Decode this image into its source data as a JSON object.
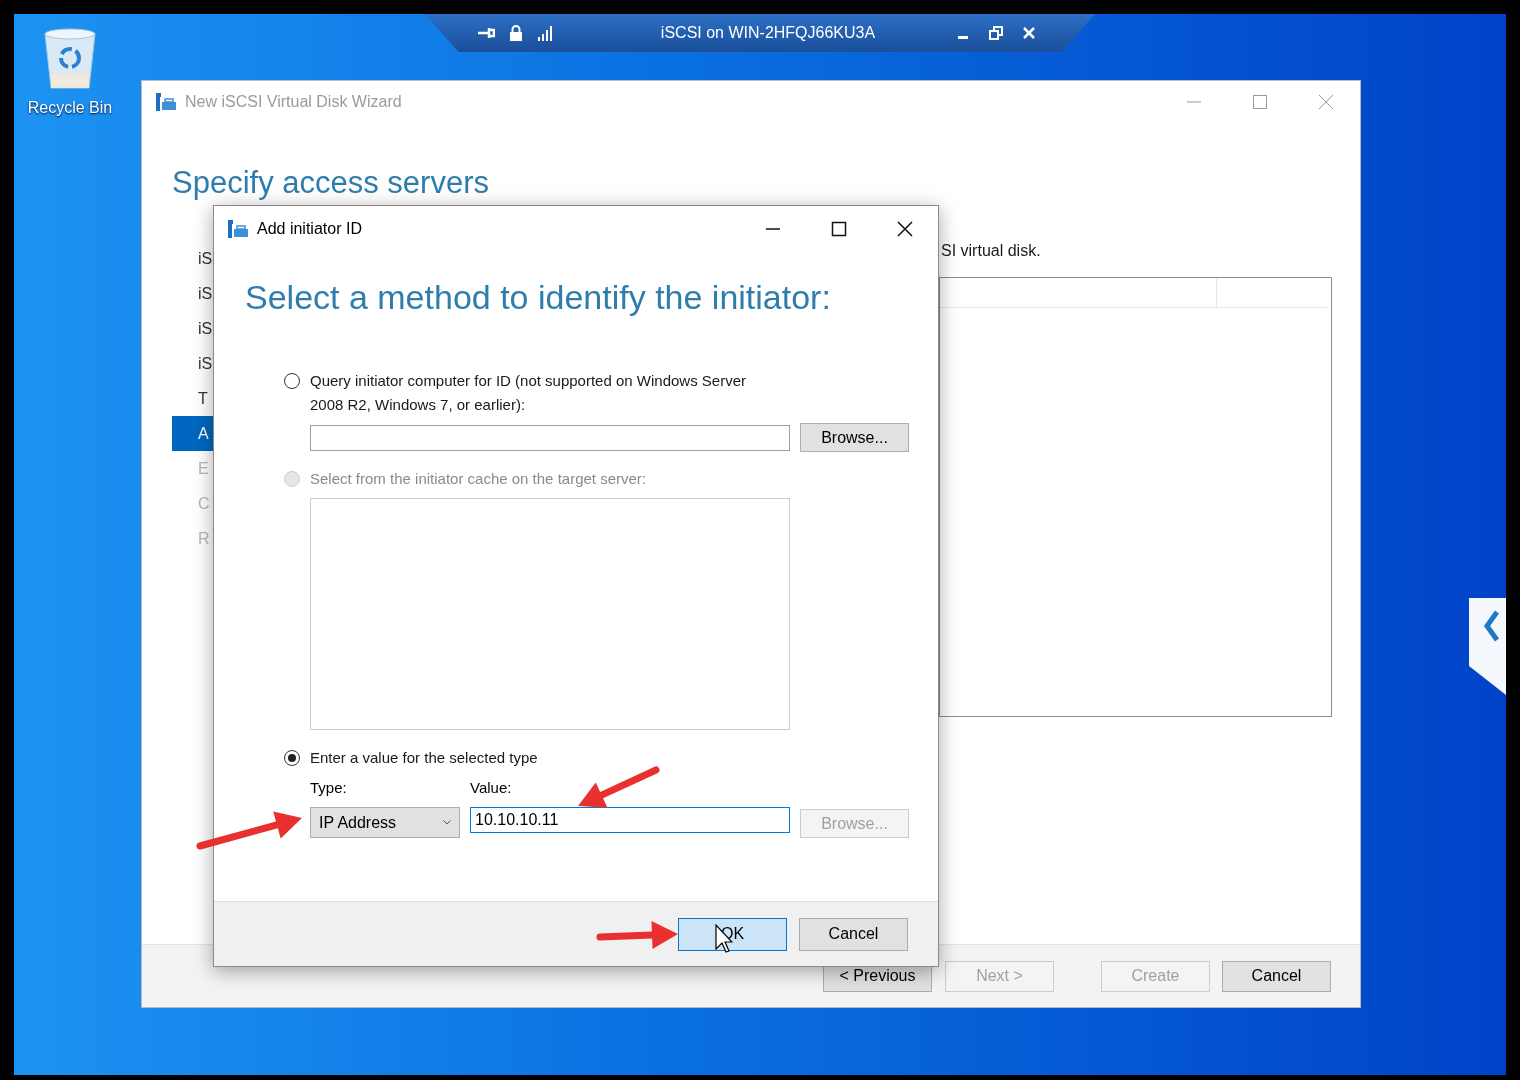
{
  "remote_bar": {
    "title": "iSCSI on WIN-2HFQJ66KU3A"
  },
  "desktop_icons": [
    {
      "label": "Recycle Bin"
    }
  ],
  "wizard": {
    "title": "New iSCSI Virtual Disk Wizard",
    "heading": "Specify access servers",
    "steps": [
      {
        "label": "iS",
        "selected": false,
        "disabled": false
      },
      {
        "label": "iS",
        "selected": false,
        "disabled": false
      },
      {
        "label": "iS",
        "selected": false,
        "disabled": false
      },
      {
        "label": "iS",
        "selected": false,
        "disabled": false
      },
      {
        "label": "T",
        "selected": false,
        "disabled": false
      },
      {
        "label": "A",
        "selected": true,
        "disabled": false
      },
      {
        "label": "E",
        "selected": false,
        "disabled": true
      },
      {
        "label": "C",
        "selected": false,
        "disabled": true
      },
      {
        "label": "R",
        "selected": false,
        "disabled": true
      }
    ],
    "description": "SI virtual disk.",
    "nav_buttons": [
      {
        "label": "< Previous",
        "disabled": false
      },
      {
        "label": "Next >",
        "disabled": true
      }
    ],
    "action_buttons": [
      {
        "label": "Create",
        "disabled": true
      },
      {
        "label": "Cancel",
        "disabled": false
      }
    ]
  },
  "dialog": {
    "title": "Add initiator ID",
    "heading": "Select a method to identify the initiator:",
    "options": [
      {
        "kind": "query",
        "label": "Query initiator computer for ID (not supported on Windows Server 2008 R2, Windows 7, or earlier):",
        "selected": false,
        "disabled": false,
        "browse": {
          "label": "Browse...",
          "disabled": false
        }
      },
      {
        "kind": "cache",
        "label": "Select from the initiator cache on the target server:",
        "selected": false,
        "disabled": true
      },
      {
        "kind": "value",
        "label": "Enter a value for the selected type",
        "selected": true,
        "disabled": false,
        "type_label": "Type:",
        "type_value": "IP Address",
        "value_label": "Value:",
        "value": "10.10.10.11",
        "browse": {
          "label": "Browse...",
          "disabled": true
        }
      }
    ],
    "buttons": [
      {
        "label": "OK",
        "focused": true
      },
      {
        "label": "Cancel",
        "focused": false
      }
    ]
  }
}
